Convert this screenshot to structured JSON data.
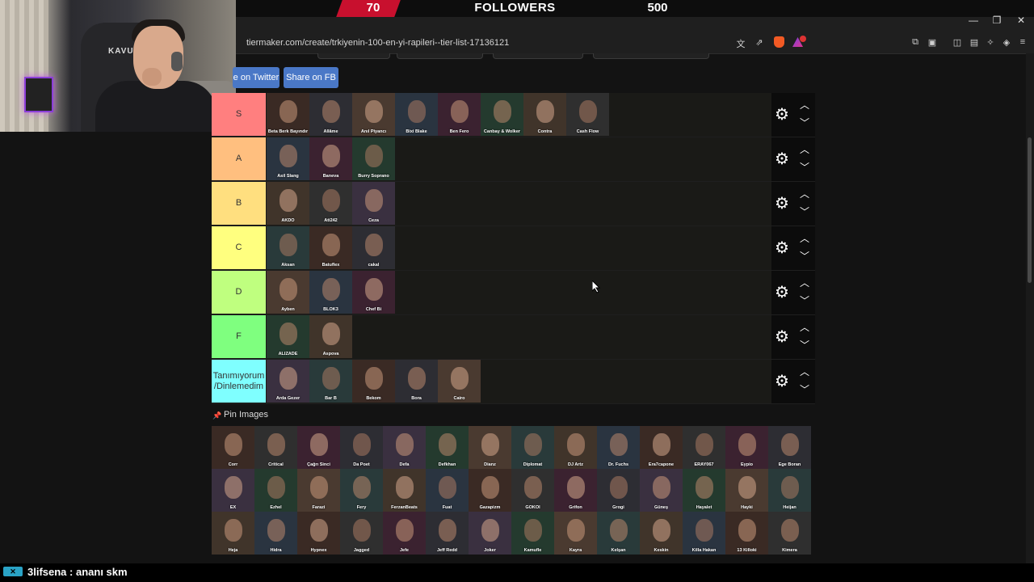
{
  "banner": {
    "current": "70",
    "label": "FOLLOWERS",
    "goal": "500"
  },
  "window": {
    "minimize": "—",
    "restore": "❐",
    "close": "✕"
  },
  "address": {
    "prefix": "s",
    "url": "tiermaker.com/create/trkiyenin-100-en-yi-rapileri--tier-list-17136121"
  },
  "webcam": {
    "chair_text": "KAVUN"
  },
  "share": {
    "twitter": "e on Twitter",
    "fb": "Share on FB"
  },
  "tiers": [
    {
      "label": "S",
      "color": "#ff7f7f",
      "items": [
        "Beta Berk Bayındır",
        "Allâme",
        "Anıl Piyancı",
        "Bixi Blake",
        "Ben Fero",
        "Canbay & Wolker",
        "Contra",
        "Cash Flow"
      ]
    },
    {
      "label": "A",
      "color": "#ffbf7f",
      "items": [
        "Asil Slang",
        "Baneva",
        "Burry Soprano"
      ]
    },
    {
      "label": "B",
      "color": "#ffdf7f",
      "items": [
        "AKDO",
        "Ati242",
        "Ceza"
      ]
    },
    {
      "label": "C",
      "color": "#ffff7f",
      "items": [
        "Aksan",
        "Batuflex",
        "cakal"
      ]
    },
    {
      "label": "D",
      "color": "#bfff7f",
      "items": [
        "Ayben",
        "BLOK3",
        "Chef Bi"
      ]
    },
    {
      "label": "F",
      "color": "#7fff7f",
      "items": [
        "ALIZADE",
        "Aspova"
      ]
    },
    {
      "label": "Tanımıyorum /Dinlemedim",
      "color": "#7fffff",
      "items": [
        "Arda Gezer",
        "Bar B",
        "Bekom",
        "Bora",
        "Cairo"
      ]
    }
  ],
  "pin_images_label": "Pin Images",
  "pool": [
    "Corr",
    "Critical",
    "Çağrı Sinci",
    "Da Poet",
    "Defa",
    "Defkhan",
    "Dianz",
    "Diplomat",
    "DJ Artz",
    "Dr. Fuchs",
    "Era7capone",
    "ERAY067",
    "Eypio",
    "Ege Boran",
    "EX",
    "Ezhel",
    "Farazi",
    "Fery",
    "FerzanBeats",
    "Fuat",
    "Gazapizm",
    "GOKOI",
    "Grifon",
    "Grogi",
    "Güneş",
    "Hayalet",
    "Hayki",
    "Heijan",
    "Heja",
    "Hidra",
    "Hypnex",
    "Jagged",
    "Jefe",
    "Jeff Redd",
    "Joker",
    "Kamufle",
    "Kayra",
    "Kelşan",
    "Keskin",
    "Killa Hakan",
    "13 Killoki",
    "Kimera"
  ],
  "chat": {
    "icon": "✕",
    "user": "3lifsena",
    "message": ": ananı skm"
  }
}
